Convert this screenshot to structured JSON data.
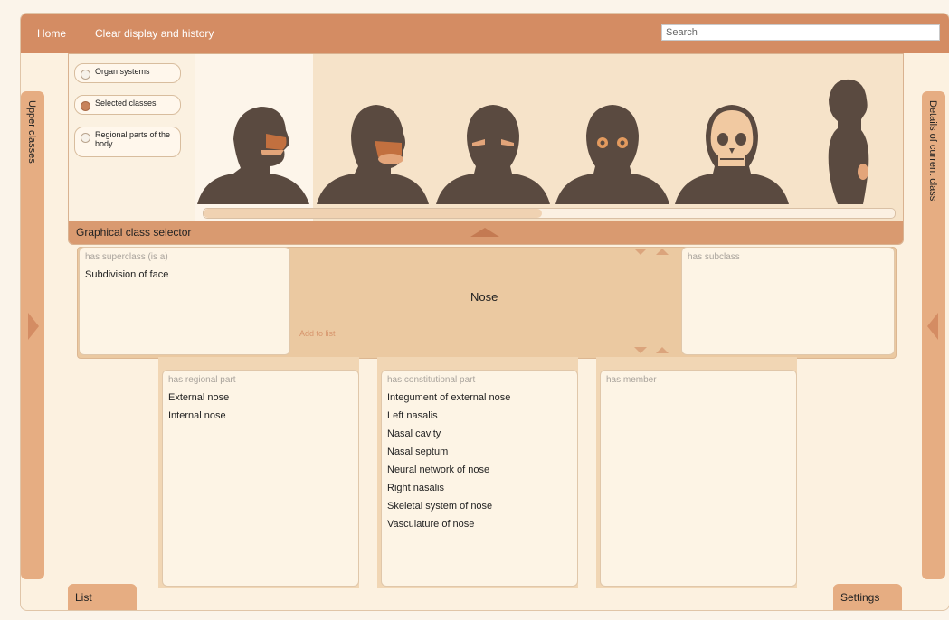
{
  "topbar": {
    "home": "Home",
    "clear": "Clear display and history",
    "search_placeholder": "Search"
  },
  "side": {
    "left_label": "Upper classes",
    "right_label": "Details of current class"
  },
  "selector": {
    "label": "Graphical class selector",
    "options": [
      {
        "label": "Organ systems",
        "selected": false
      },
      {
        "label": "Selected classes",
        "selected": true
      },
      {
        "label": "Regional parts of the body",
        "selected": false
      }
    ],
    "scroll_fraction": 0.49
  },
  "center": {
    "superclass_header": "has superclass (is a)",
    "superclass_items": [
      "Subdivision of face"
    ],
    "current_class": "Nose",
    "add_to_list": "Add to list",
    "subclass_header": "has subclass"
  },
  "bottom": {
    "regional": {
      "header": "has regional part",
      "items": [
        "External nose",
        "Internal nose"
      ]
    },
    "constitutional": {
      "header": "has constitutional part",
      "items": [
        "Integument of external nose",
        "Left nasalis",
        "Nasal cavity",
        "Nasal septum",
        "Neural network of nose",
        "Right nasalis",
        "Skeletal system of nose",
        "Vasculature of nose"
      ]
    },
    "member": {
      "header": "has member",
      "items": []
    }
  },
  "tabs": {
    "list": "List",
    "settings": "Settings"
  },
  "colors": {
    "accent": "#d48c63",
    "panel": "#fdf4e5",
    "band": "#ebc9a1",
    "silhouette": "#5a4a40",
    "highlight": "#c2703f"
  }
}
